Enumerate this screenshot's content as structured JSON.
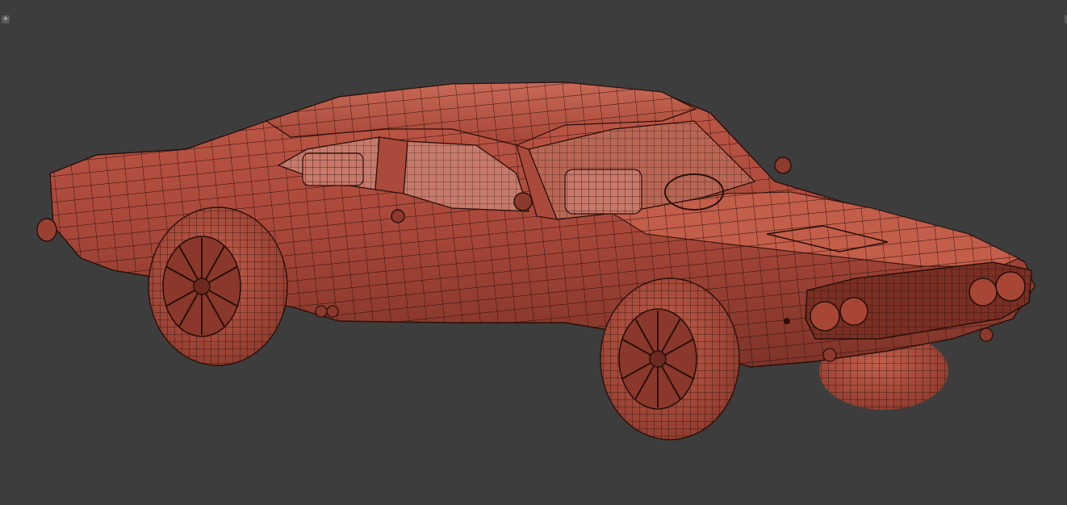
{
  "viewport": {
    "menu_glyph": "+",
    "background": "#3d3d3d",
    "shade_color": "#b5503f",
    "wire_color": "#2a0f0b"
  },
  "model": {
    "icon": "wireframe-car-model"
  }
}
